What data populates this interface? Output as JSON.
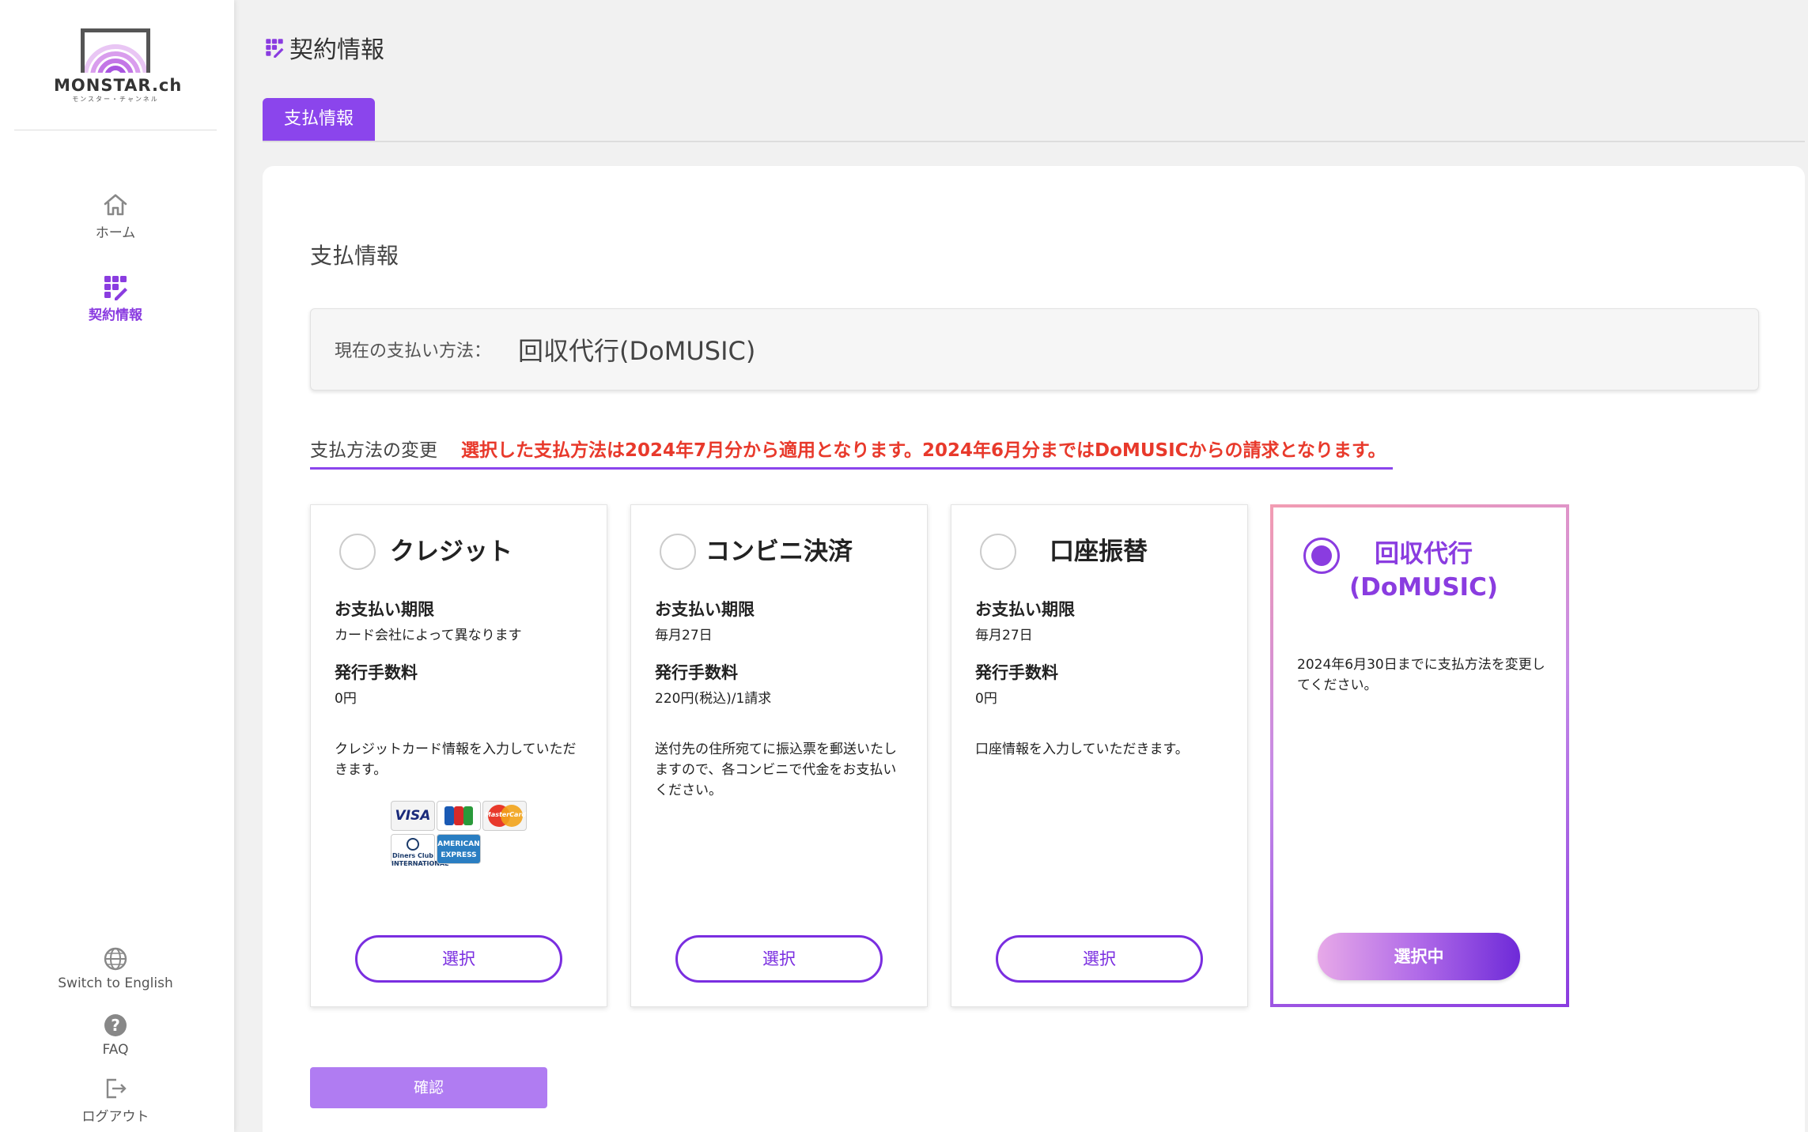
{
  "brand": {
    "name": "MONSTAR.ch",
    "subtitle": "モンスター・チャンネル"
  },
  "sidebar": {
    "home_label": "ホーム",
    "contract_label": "契約情報",
    "english_label": "Switch to English",
    "faq_label": "FAQ",
    "logout_label": "ログアウト"
  },
  "page": {
    "title": "契約情報",
    "tab_label": "支払情報",
    "section_title": "支払情報"
  },
  "current_method": {
    "label": "現在の支払い方法：",
    "value": "回収代行(DoMUSIC)"
  },
  "change": {
    "label": "支払方法の変更",
    "notice": "選択した支払方法は2024年7月分から適用となります。2024年6月分まではDoMUSICからの請求となります。"
  },
  "options": {
    "credit": {
      "name": "クレジット",
      "deadline_label": "お支払い期限",
      "deadline_value": "カード会社によって異なります",
      "fee_label": "発行手数料",
      "fee_value": "0円",
      "description": "クレジットカード情報を入力していただきます。",
      "button": "選択",
      "card_brands": [
        "VISA",
        "JCB",
        "MasterCard",
        "Diners Club INTERNATIONAL",
        "AMERICAN EXPRESS"
      ]
    },
    "konbini": {
      "name": "コンビニ決済",
      "deadline_label": "お支払い期限",
      "deadline_value": "毎月27日",
      "fee_label": "発行手数料",
      "fee_value": "220円(税込)/1請求",
      "description": "送付先の住所宛てに振込票を郵送いたしますので、各コンビニで代金をお支払いください。",
      "button": "選択"
    },
    "bank": {
      "name": "口座振替",
      "deadline_label": "お支払い期限",
      "deadline_value": "毎月27日",
      "fee_label": "発行手数料",
      "fee_value": "0円",
      "description": "口座情報を入力していただきます。",
      "button": "選択"
    },
    "domusic": {
      "name_line1": "回収代行",
      "name_line2": "(DoMUSIC)",
      "description": "2024年6月30日までに支払方法を変更してください。",
      "button": "選択中",
      "selected": true
    }
  },
  "confirm_button": "確認",
  "colors": {
    "accent": "#8b45ec",
    "notice": "#e8392b",
    "confirm": "#b07cf2"
  }
}
